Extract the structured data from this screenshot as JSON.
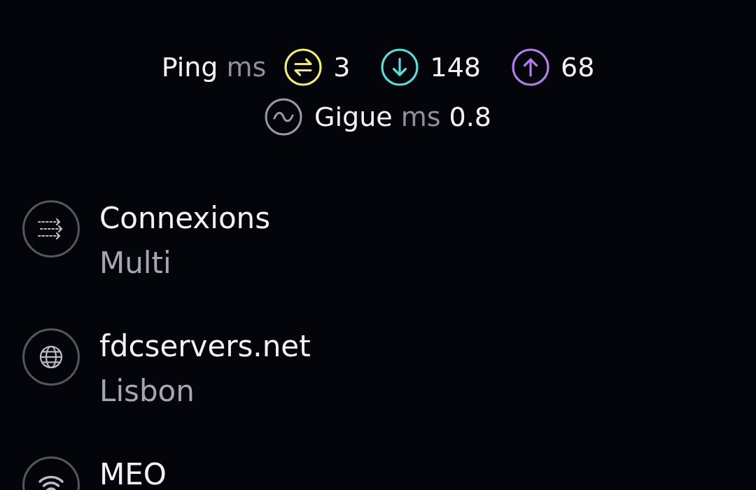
{
  "metrics": {
    "ping": {
      "label": "Ping",
      "unit": "ms"
    },
    "values": [
      {
        "kind": "idle",
        "value": "3",
        "color": "#f3e77c"
      },
      {
        "kind": "download",
        "value": "148",
        "color": "#5fdad4"
      },
      {
        "kind": "upload",
        "value": "68",
        "color": "#b07fe9"
      }
    ],
    "jitter": {
      "label": "Gigue",
      "unit": "ms",
      "value": "0.8"
    }
  },
  "details": [
    {
      "kind": "connections",
      "title": "Connexions",
      "subtitle": "Multi"
    },
    {
      "kind": "server",
      "title": "fdcservers.net",
      "subtitle": "Lisbon"
    },
    {
      "kind": "provider",
      "title": "MEO"
    }
  ]
}
